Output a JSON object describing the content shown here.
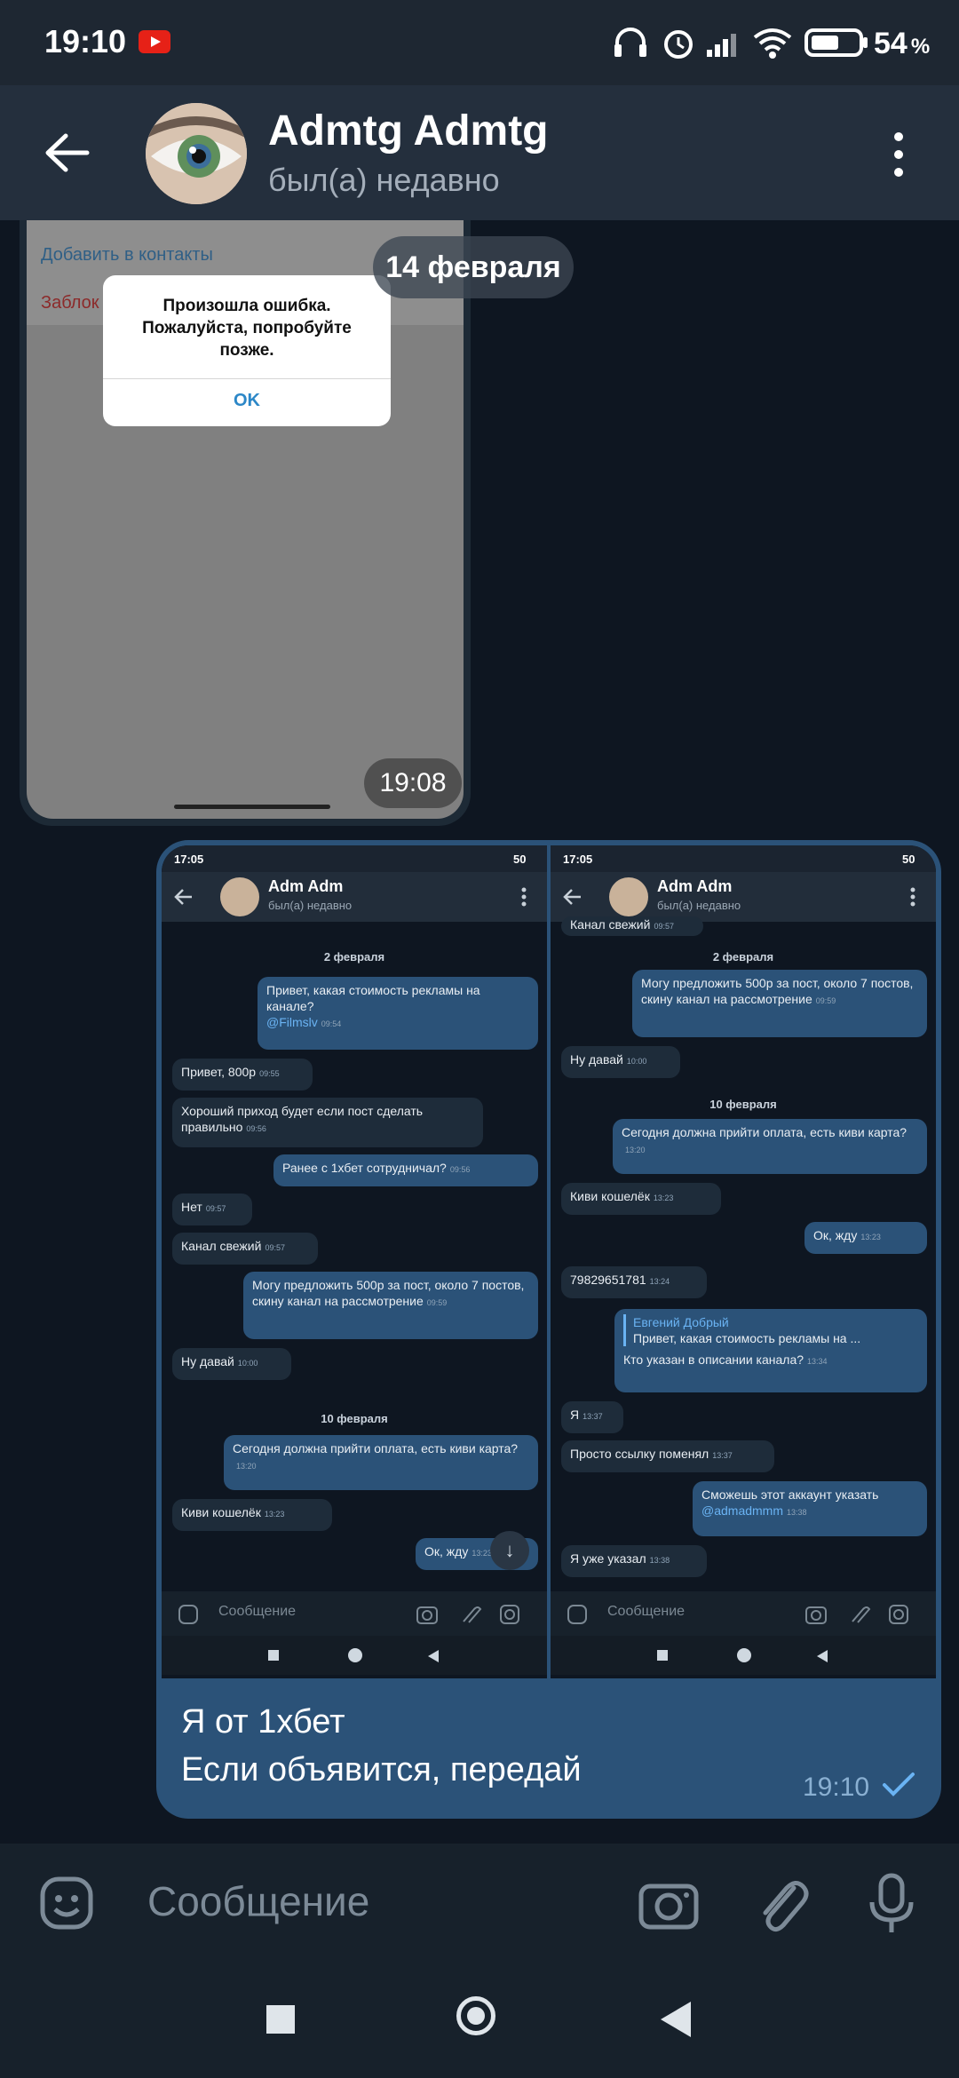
{
  "status_bar": {
    "time": "19:10",
    "battery_percent": "54",
    "battery_unit": "%"
  },
  "header": {
    "title": "Admtg Admtg",
    "subtitle": "был(а) недавно"
  },
  "date_separator": "14 февраля",
  "message1": {
    "time": "19:08",
    "screenshot": {
      "menu_add_contact": "Добавить в контакты",
      "menu_block": "Заблок",
      "dialog_text": "Произошла ошибка. Пожалуйста, попробуйте позже.",
      "dialog_ok": "OK"
    }
  },
  "message2": {
    "text_line1": "Я от 1хбет",
    "text_line2": "Если объявится, передай",
    "time": "19:10",
    "left_screenshot": {
      "status_time": "17:05",
      "status_batt": "50",
      "chat_title": "Adm Adm",
      "chat_subtitle": "был(а) недавно",
      "date1": "2 февраля",
      "m1": "Привет, какая стоимость рекламы на канале?",
      "m1_link": "@Filmslv",
      "m1_time": "09:54",
      "m2": "Привет, 800р",
      "m2_time": "09:55",
      "m3": "Хороший приход будет если пост сделать правильно",
      "m3_time": "09:56",
      "m4": "Ранее с 1хбет сотрудничал?",
      "m4_time": "09:56",
      "m5": "Нет",
      "m5_time": "09:57",
      "m6": "Канал свежий",
      "m6_time": "09:57",
      "m7": "Могу предложить 500р за пост, около 7 постов, скину канал на рассмотрение",
      "m7_time": "09:59",
      "m8": "Ну давай",
      "m8_time": "10:00",
      "date2": "10 февраля",
      "m9": "Сегодня должна прийти оплата, есть киви карта?",
      "m9_time": "13:20",
      "m10": "Киви кошелёк",
      "m10_time": "13:23",
      "m11": "Ок, жду",
      "m11_time": "13:23",
      "input_placeholder": "Сообщение"
    },
    "right_screenshot": {
      "status_time": "17:05",
      "status_batt": "50",
      "chat_title": "Adm Adm",
      "chat_subtitle": "был(а) недавно",
      "top_cut": "Канал свежий",
      "top_cut_time": "09:57",
      "date1": "2 февраля",
      "m1": "Могу предложить 500р за пост, около 7 постов, скину канал на рассмотрение",
      "m1_time": "09:59",
      "m2": "Ну давай",
      "m2_time": "10:00",
      "date2": "10 февраля",
      "m3": "Сегодня должна прийти оплата, есть киви карта?",
      "m3_time": "13:20",
      "m4": "Киви кошелёк",
      "m4_time": "13:23",
      "m5": "Ок, жду",
      "m5_time": "13:23",
      "m6": "79829651781",
      "m6_time": "13:24",
      "reply_name": "Евгений Добрый",
      "reply_text": "Привет, какая стоимость рекламы на ...",
      "m7": "Кто указан в описании канала?",
      "m7_time": "13:34",
      "m8": "Я",
      "m8_time": "13:37",
      "m9": "Просто ссылку поменял",
      "m9_time": "13:37",
      "m10": "Сможешь этот аккаунт указать",
      "m10_link": "@admadmmm",
      "m10_time": "13:38",
      "m11": "Я уже указал",
      "m11_time": "13:38",
      "input_placeholder": "Сообщение"
    }
  },
  "input": {
    "placeholder": "Сообщение"
  },
  "icons": [
    "back-arrow-icon",
    "more-vert-icon",
    "emoji-icon",
    "camera-icon",
    "attach-icon",
    "mic-icon",
    "nav-square-icon",
    "nav-home-icon",
    "nav-back-icon"
  ]
}
